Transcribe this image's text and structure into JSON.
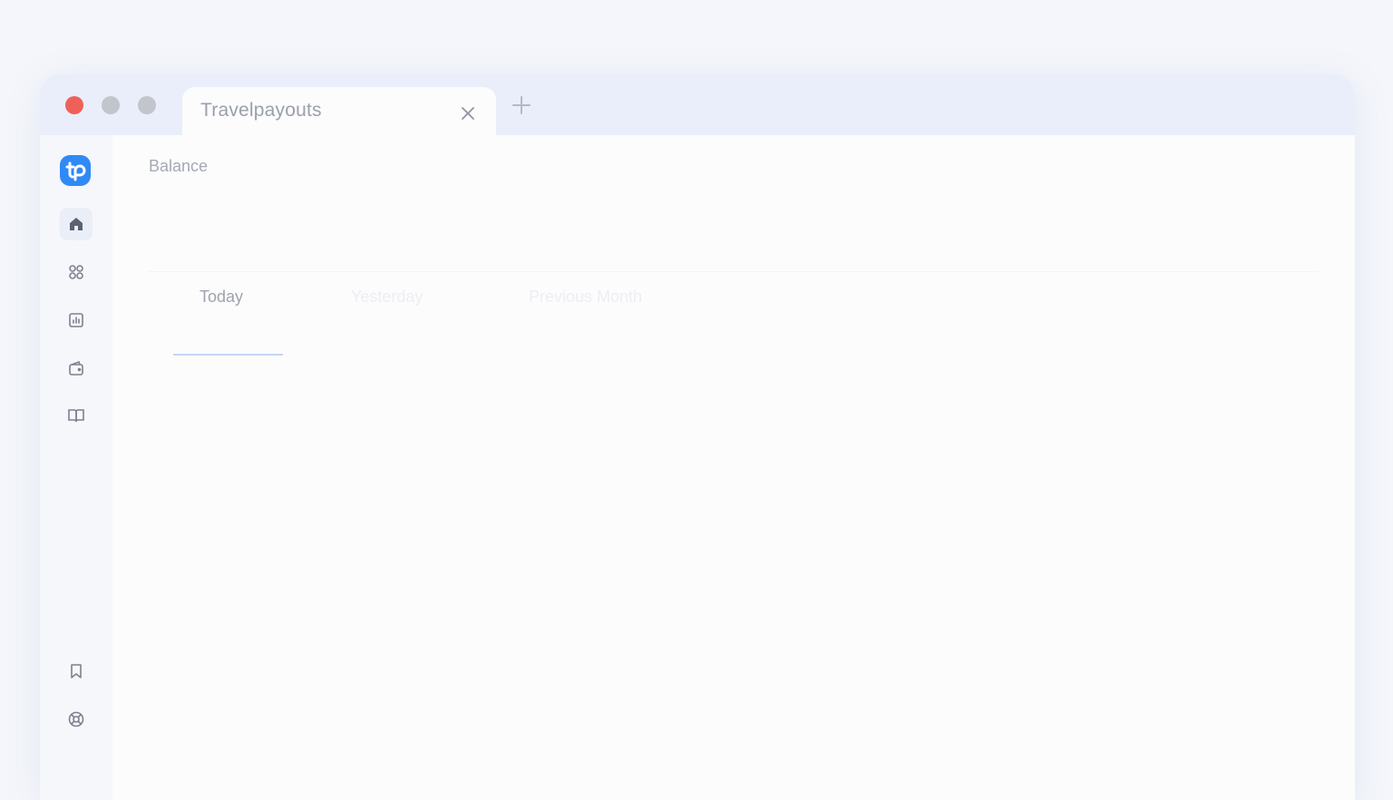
{
  "browser": {
    "tab_title": "Travelpayouts",
    "close_icon": "close-icon",
    "new_tab_icon": "plus-icon"
  },
  "sidebar": {
    "logo": "travelpayouts-logo",
    "items": [
      {
        "icon": "home-icon",
        "active": true
      },
      {
        "icon": "grid-icon",
        "active": false
      },
      {
        "icon": "chart-icon",
        "active": false
      },
      {
        "icon": "wallet-icon",
        "active": false
      },
      {
        "icon": "book-icon",
        "active": false
      }
    ],
    "bottom_items": [
      {
        "icon": "bookmark-icon"
      },
      {
        "icon": "lifebuoy-icon"
      }
    ]
  },
  "main": {
    "balance_label": "Balance",
    "period_tabs": [
      {
        "label": "Today",
        "selected": true
      },
      {
        "label": "Yesterday",
        "selected": false
      },
      {
        "label": "Previous Month",
        "selected": false
      }
    ]
  },
  "colors": {
    "accent": "#2f8af5",
    "close_dot": "#f0605a",
    "inactive_dot": "#c3c5cc",
    "titlebar": "#e9eefa"
  }
}
